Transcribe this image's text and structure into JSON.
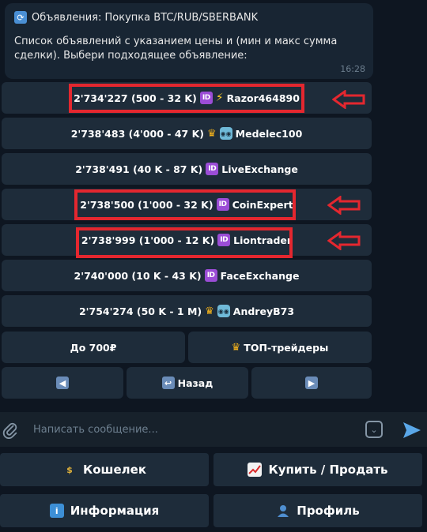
{
  "message": {
    "title": "Объявления: Покупка BTC/RUB/SBERBANK",
    "text": "Список объявлений с указанием цены и (мин и макс сумма сделки). Выбери подходящее объявление:",
    "time": "16:28"
  },
  "offers": [
    {
      "price": "2'734'227 (500 - 32 K)",
      "badges": [
        "id",
        "bolt"
      ],
      "seller": "Razor464890"
    },
    {
      "price": "2'738'483 (4'000 - 47 K)",
      "badges": [
        "crown",
        "robot"
      ],
      "seller": "Medelec100"
    },
    {
      "price": "2'738'491 (40 K - 87 K)",
      "badges": [
        "id"
      ],
      "seller": "LiveExchange"
    },
    {
      "price": "2'738'500 (1'000 - 32 K)",
      "badges": [
        "id"
      ],
      "seller": "CoinExpert"
    },
    {
      "price": "2'738'999 (1'000 - 12 K)",
      "badges": [
        "id"
      ],
      "seller": "Liontrader"
    },
    {
      "price": "2'740'000 (10 K - 43 K)",
      "badges": [
        "id"
      ],
      "seller": "FaceExchange"
    },
    {
      "price": "2'754'274 (50 K - 1 M)",
      "badges": [
        "crown",
        "robot"
      ],
      "seller": "AndreyB73"
    }
  ],
  "filters": {
    "under_label": "До 700₽",
    "top_label": "ТОП-трейдеры"
  },
  "nav": {
    "back_label": "Назад"
  },
  "composer": {
    "placeholder": "Написать сообщение..."
  },
  "reply_keyboard": {
    "wallet": "Кошелек",
    "trade": "Купить / Продать",
    "info": "Информация",
    "profile": "Профиль"
  },
  "colors": {
    "background": "#0e1621",
    "button": "#1e2c3a",
    "highlight": "#e4272f",
    "id_badge": "#9b4dd6",
    "send": "#5aa7e8"
  }
}
